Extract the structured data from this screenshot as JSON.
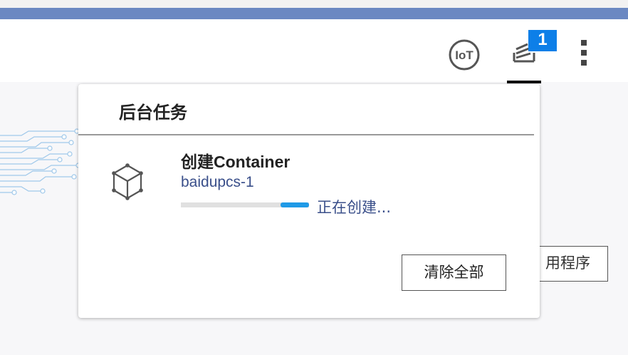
{
  "header": {
    "iot_label": "IoT",
    "task_badge_count": "1"
  },
  "background": {
    "app_button_label": "用程序"
  },
  "task_panel": {
    "title": "后台任务",
    "tasks": [
      {
        "name": "创建Container",
        "subtitle": "baidupcs-1",
        "status": "正在创建...",
        "icon": "cube-icon"
      }
    ],
    "clear_all_label": "清除全部"
  },
  "colors": {
    "top_bar": "#6b88c2",
    "badge": "#0d7fe8",
    "progress": "#1f9ae6",
    "link_text": "#3a4f8a"
  }
}
